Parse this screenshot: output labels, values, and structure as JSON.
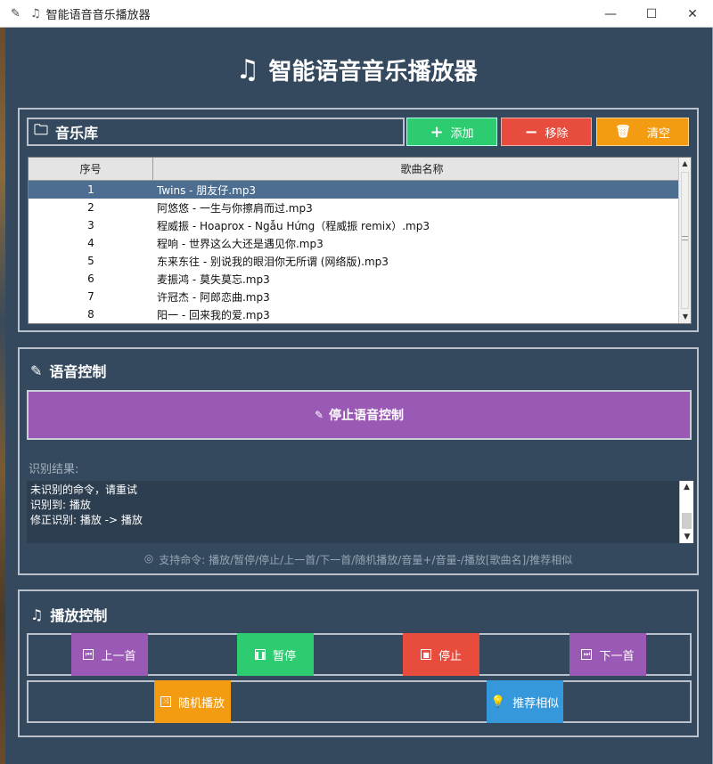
{
  "window": {
    "title": "智能语音音乐播放器",
    "minimize": "—",
    "maximize": "☐",
    "close": "✕"
  },
  "app": {
    "title": "智能语音音乐播放器"
  },
  "library": {
    "title": "音乐库",
    "add_label": "添加",
    "remove_label": "移除",
    "clear_label": "清空",
    "columns": [
      "序号",
      "歌曲名称"
    ],
    "rows": [
      {
        "index": "1",
        "name": "Twins - 朋友仔.mp3",
        "selected": true
      },
      {
        "index": "2",
        "name": "阿悠悠 - 一生与你擦肩而过.mp3"
      },
      {
        "index": "3",
        "name": "程威振 - Hoaprox - Ngẫu Hứng（程威振 remix）.mp3"
      },
      {
        "index": "4",
        "name": "程响 - 世界这么大还是遇见你.mp3"
      },
      {
        "index": "5",
        "name": "东来东往 - 别说我的眼泪你无所谓 (网络版).mp3"
      },
      {
        "index": "6",
        "name": "麦振鸿 - 莫失莫忘.mp3"
      },
      {
        "index": "7",
        "name": "许冠杰 - 阿郎恋曲.mp3"
      },
      {
        "index": "8",
        "name": "阳一 - 回来我的爱.mp3"
      }
    ]
  },
  "voice": {
    "title": "语音控制",
    "toggle_label": "停止语音控制",
    "result_label": "识别结果:",
    "result_lines": [
      "未识别的命令，请重试",
      "识别到: 播放",
      "修正识别: 播放 -> 播放"
    ],
    "help": "支持命令: 播放/暂停/停止/上一首/下一首/随机播放/音量+/音量-/播放[歌曲名]/推荐相似"
  },
  "playback": {
    "title": "播放控制",
    "prev_label": "上一首",
    "pause_label": "暂停",
    "stop_label": "停止",
    "next_label": "下一首",
    "shuffle_label": "随机播放",
    "recommend_label": "推荐相似"
  },
  "colors": {
    "background": "#34495e",
    "green": "#2ecc71",
    "red": "#e74c3c",
    "orange": "#f39c12",
    "purple": "#9b59b6",
    "blue": "#3498db"
  }
}
